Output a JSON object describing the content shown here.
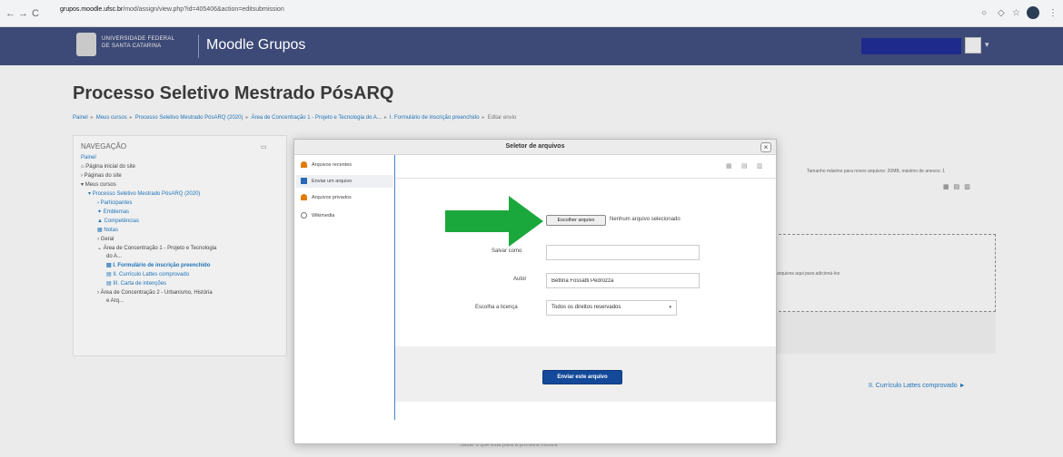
{
  "browser": {
    "url_domain": "grupos.moodle.ufsc.br",
    "url_path": "/mod/assign/view.php?id=405406&action=editsubmission",
    "nav_back": "←",
    "nav_forward": "→",
    "nav_reload": "C"
  },
  "navbar": {
    "logo_line1": "UNIVERSIDADE FEDERAL",
    "logo_line2": "DE SANTA CATARINA",
    "brand": "Moodle Grupos",
    "caret": "▾"
  },
  "page": {
    "title": "Processo Seletivo Mestrado PósARQ",
    "breadcrumbs": [
      "Painel",
      "Meus cursos",
      "Processo Seletivo Mestrado PósARQ (2020)",
      "Área de Concentração 1 - Projeto e Tecnologia do A...",
      "I. Formulário de inscrição preenchido",
      "Editar envio"
    ],
    "breadcrumb_sep": "▸",
    "next_link": "II. Currículo Lattes comprovado ►",
    "footer_link": "Saltar o que está para a primeira mostra"
  },
  "navigation": {
    "header": "NAVEGAÇÃO",
    "items": [
      "Painel",
      "Página inicial do site",
      "Páginas do site",
      "Meus cursos",
      "Processo Seletivo Mestrado PósARQ (2020)",
      "Participantes",
      "Emblemas",
      "Competências",
      "Notas",
      "Geral",
      "Área de Concentração 1 - Projeto e Tecnologia",
      "do A...",
      "I. Formulário de inscrição preenchido",
      "II. Currículo Lattes comprovado",
      "III. Carta de intenções",
      "Área de Concentração 2 - Urbanismo, História",
      "e Arq..."
    ]
  },
  "background": {
    "size_hint": "Tamanho máximo para novos arquivos: 20MB, máximo de anexos: 1",
    "drop_text": "arquivos aqui para adicioná-los"
  },
  "file_picker": {
    "title": "Seletor de arquivos",
    "close": "×",
    "repositories": [
      {
        "label": "Arquivos recentes",
        "icon": "recent-files-icon",
        "color": "#e07b00"
      },
      {
        "label": "Enviar um arquivo",
        "icon": "upload-file-icon",
        "color": "#2a67b4"
      },
      {
        "label": "Arquivos privados",
        "icon": "private-files-icon",
        "color": "#e07b00"
      },
      {
        "label": "Wikimedia",
        "icon": "wikimedia-icon",
        "color": "#777777"
      }
    ],
    "form": {
      "choose_button": "Escolher arquivo",
      "no_file": "Nenhum arquivo selecionado",
      "save_as_label": "Salvar como",
      "save_as_value": "",
      "author_label": "Autor",
      "author_value": "Bettina Fossatti Pedrozza",
      "license_label": "Escolha a licença",
      "license_value": "Todos os direitos reservados"
    },
    "upload_button": "Enviar este arquivo"
  },
  "colors": {
    "navbar": "#3d4a77",
    "link": "#1f73b7",
    "primary_button": "#14499a",
    "arrow": "#1aa83c"
  }
}
